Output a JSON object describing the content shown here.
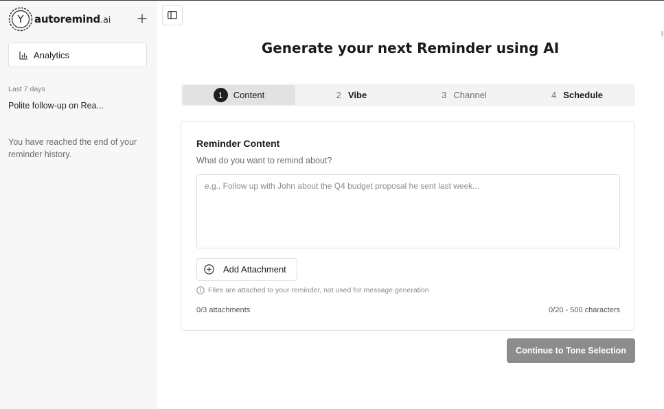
{
  "brand": {
    "logo_letter": "Y",
    "name": "autoremind",
    "suffix": ".ai"
  },
  "sidebar": {
    "new_icon": "plus-icon",
    "analytics": {
      "label": "Analytics",
      "icon": "bar-chart-icon"
    },
    "section_label": "Last 7 days",
    "history": [
      {
        "title": "Polite follow-up on Rea..."
      }
    ],
    "end_note": "You have reached the end of your reminder history."
  },
  "toolbar": {
    "toggle_icon": "sidebar-toggle-icon"
  },
  "main": {
    "title": "Generate your next Reminder using AI",
    "steps": [
      {
        "num": "1",
        "label": "Content",
        "active": true
      },
      {
        "num": "2",
        "label": "Vibe",
        "active": false
      },
      {
        "num": "3",
        "label": "Channel",
        "active": false
      },
      {
        "num": "4",
        "label": "Schedule",
        "active": false
      }
    ],
    "card": {
      "title": "Reminder Content",
      "subtitle": "What do you want to remind about?",
      "input_value": "",
      "input_placeholder": "e.g., Follow up with John about the Q4 budget proposal he sent last week...",
      "attach_label": "Add Attachment",
      "attach_icon": "plus-circle-icon",
      "hint_icon": "info-icon",
      "hint": "Files are attached to your reminder, not used for message generation",
      "attachments_count": "0/3 attachments",
      "char_count": "0/20 - 500 characters"
    },
    "continue_label": "Continue to Tone Selection"
  },
  "colors": {
    "sidebar_bg": "#f7f7f8",
    "active_step_bg": "#e2e2e5",
    "step_badge": "#1f1f1f",
    "continue_disabled": "#8c8c8f"
  }
}
